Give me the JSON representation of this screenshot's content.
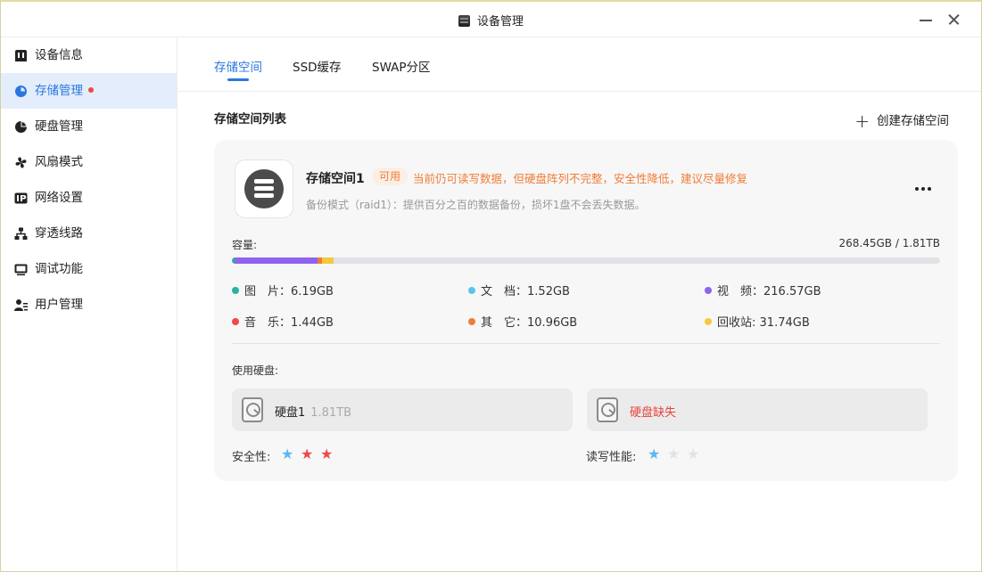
{
  "window": {
    "title": "设备管理"
  },
  "sidebar": {
    "items": [
      {
        "label": "设备信息",
        "icon": "device-info-icon"
      },
      {
        "label": "存储管理",
        "icon": "storage-pie-icon",
        "active": true,
        "has_dot": true
      },
      {
        "label": "硬盘管理",
        "icon": "disk-pie-icon"
      },
      {
        "label": "风扇模式",
        "icon": "fan-icon"
      },
      {
        "label": "网络设置",
        "icon": "ip-icon"
      },
      {
        "label": "穿透线路",
        "icon": "network-tree-icon"
      },
      {
        "label": "调试功能",
        "icon": "monitor-icon"
      },
      {
        "label": "用户管理",
        "icon": "users-icon"
      }
    ],
    "dot_color": "#f0484a"
  },
  "tabs": [
    {
      "label": "存储空间",
      "active": true
    },
    {
      "label": "SSD缓存"
    },
    {
      "label": "SWAP分区"
    }
  ],
  "section": {
    "title": "存储空间列表",
    "create_label": "创建存储空间"
  },
  "pool": {
    "name": "存储空间1",
    "status": "可用",
    "warning": "当前仍可读写数据，但硬盘阵列不完整，安全性降低，建议尽量修复",
    "description": "备份模式（raid1）：提供百分之百的数据备份，损坏1盘不会丢失数据。",
    "capacity_label": "容量:",
    "capacity_value": "268.45GB / 1.81TB",
    "capacity_segments": [
      {
        "name": "图 片",
        "fraction": 0.0035,
        "color": "#26b3a4"
      },
      {
        "name": "视 频",
        "fraction": 0.1165,
        "color": "#8f63f0"
      },
      {
        "name": "其 它",
        "fraction": 0.006,
        "color": "#f07c36"
      },
      {
        "name": "回收站",
        "fraction": 0.017,
        "color": "#f5c842"
      }
    ],
    "legend": [
      {
        "label": "图　片",
        "value": "：6.19GB",
        "color": "#26b3a4"
      },
      {
        "label": "文　档",
        "value": "：1.52GB",
        "color": "#5ec3ea"
      },
      {
        "label": "视　频",
        "value": "：216.57GB",
        "color": "#8f63f0"
      },
      {
        "label": "音　乐",
        "value": "：1.44GB",
        "color": "#f0484a"
      },
      {
        "label": "其　它",
        "value": "：10.96GB",
        "color": "#f07c36"
      },
      {
        "label": "回收站",
        "value": ": 31.74GB",
        "color": "#f5c842"
      }
    ],
    "disks_label": "使用硬盘:",
    "disks": [
      {
        "name": "硬盘1",
        "size": "1.81TB",
        "missing": false
      },
      {
        "name": "硬盘缺失",
        "missing": true
      }
    ],
    "security_label": "安全性:",
    "security_stars": [
      "#5ab8f0",
      "#f0484a",
      "#f0484a"
    ],
    "performance_label": "读写性能:",
    "performance_stars": [
      "#5ab8f0",
      "#e2e2e6",
      "#e2e2e6"
    ]
  },
  "colors": {
    "accent": "#2a77e0",
    "warning": "#f07c36",
    "error": "#e5443d"
  }
}
